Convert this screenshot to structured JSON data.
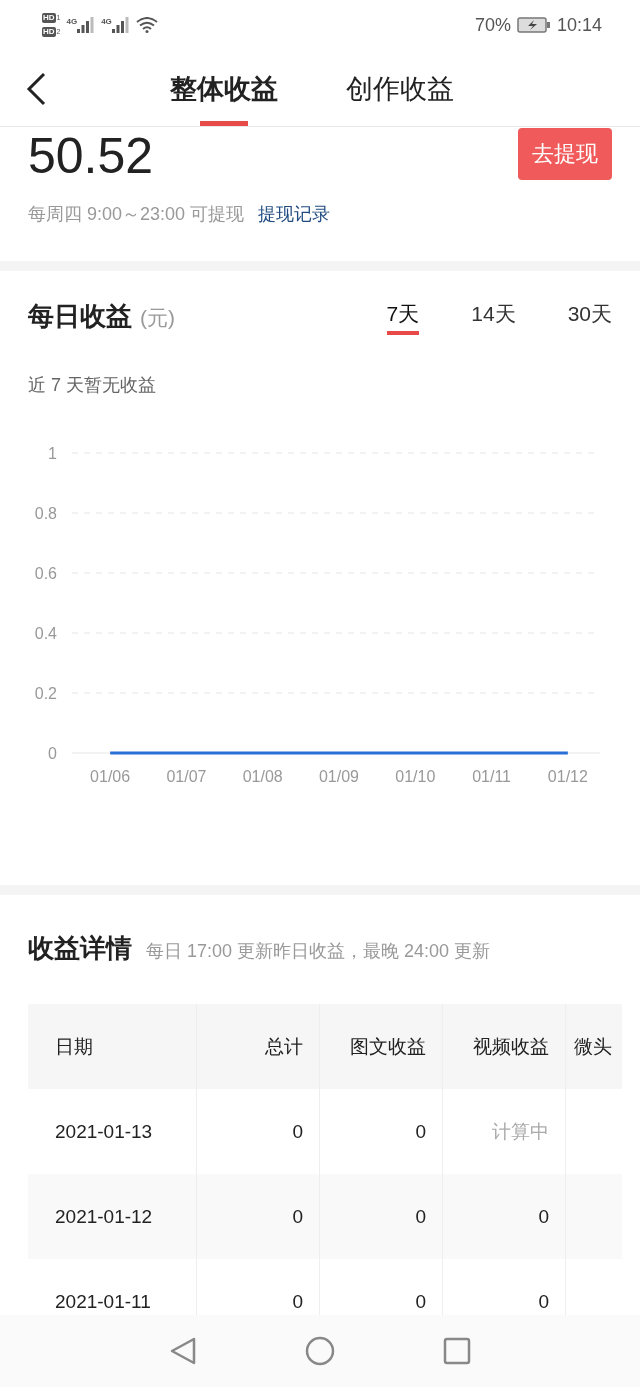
{
  "status_bar": {
    "sims": [
      {
        "badge": "HD",
        "slot": "1",
        "network": "4G"
      },
      {
        "badge": "HD",
        "slot": "2",
        "network": "4G"
      }
    ],
    "battery": "70%",
    "time": "10:14"
  },
  "header": {
    "tabs": [
      {
        "label": "整体收益",
        "selected": true
      },
      {
        "label": "创作收益",
        "selected": false
      }
    ]
  },
  "balance": {
    "amount": "50.52",
    "withdraw_button": "去提现",
    "note": "每周四 9:00～23:00 可提现",
    "record_link": "提现记录"
  },
  "daily": {
    "title": "每日收益",
    "unit": "(元)",
    "ranges": [
      {
        "label": "7天",
        "selected": true
      },
      {
        "label": "14天",
        "selected": false
      },
      {
        "label": "30天",
        "selected": false
      }
    ],
    "empty_note": "近 7 天暂无收益",
    "chart_data": {
      "type": "line",
      "categories": [
        "01/06",
        "01/07",
        "01/08",
        "01/09",
        "01/10",
        "01/11",
        "01/12"
      ],
      "series": [
        {
          "color": "#2a6fd6",
          "values": [
            0,
            0,
            0,
            0,
            0,
            0,
            0
          ]
        }
      ],
      "grid": true,
      "ylim": [
        0,
        1
      ],
      "yticks": [
        0,
        0.2,
        0.4,
        0.6,
        0.8,
        1
      ]
    }
  },
  "details": {
    "title": "收益详情",
    "subtitle": "每日 17:00 更新昨日收益，最晚 24:00 更新",
    "columns": [
      "日期",
      "总计",
      "图文收益",
      "视频收益",
      "微头"
    ],
    "rows": [
      {
        "date": "2021-01-13",
        "total": "0",
        "article": "0",
        "video": "计算中",
        "video_pending": true
      },
      {
        "date": "2021-01-12",
        "total": "0",
        "article": "0",
        "video": "0",
        "video_pending": false
      },
      {
        "date": "2021-01-11",
        "total": "0",
        "article": "0",
        "video": "0",
        "video_pending": false
      }
    ]
  }
}
